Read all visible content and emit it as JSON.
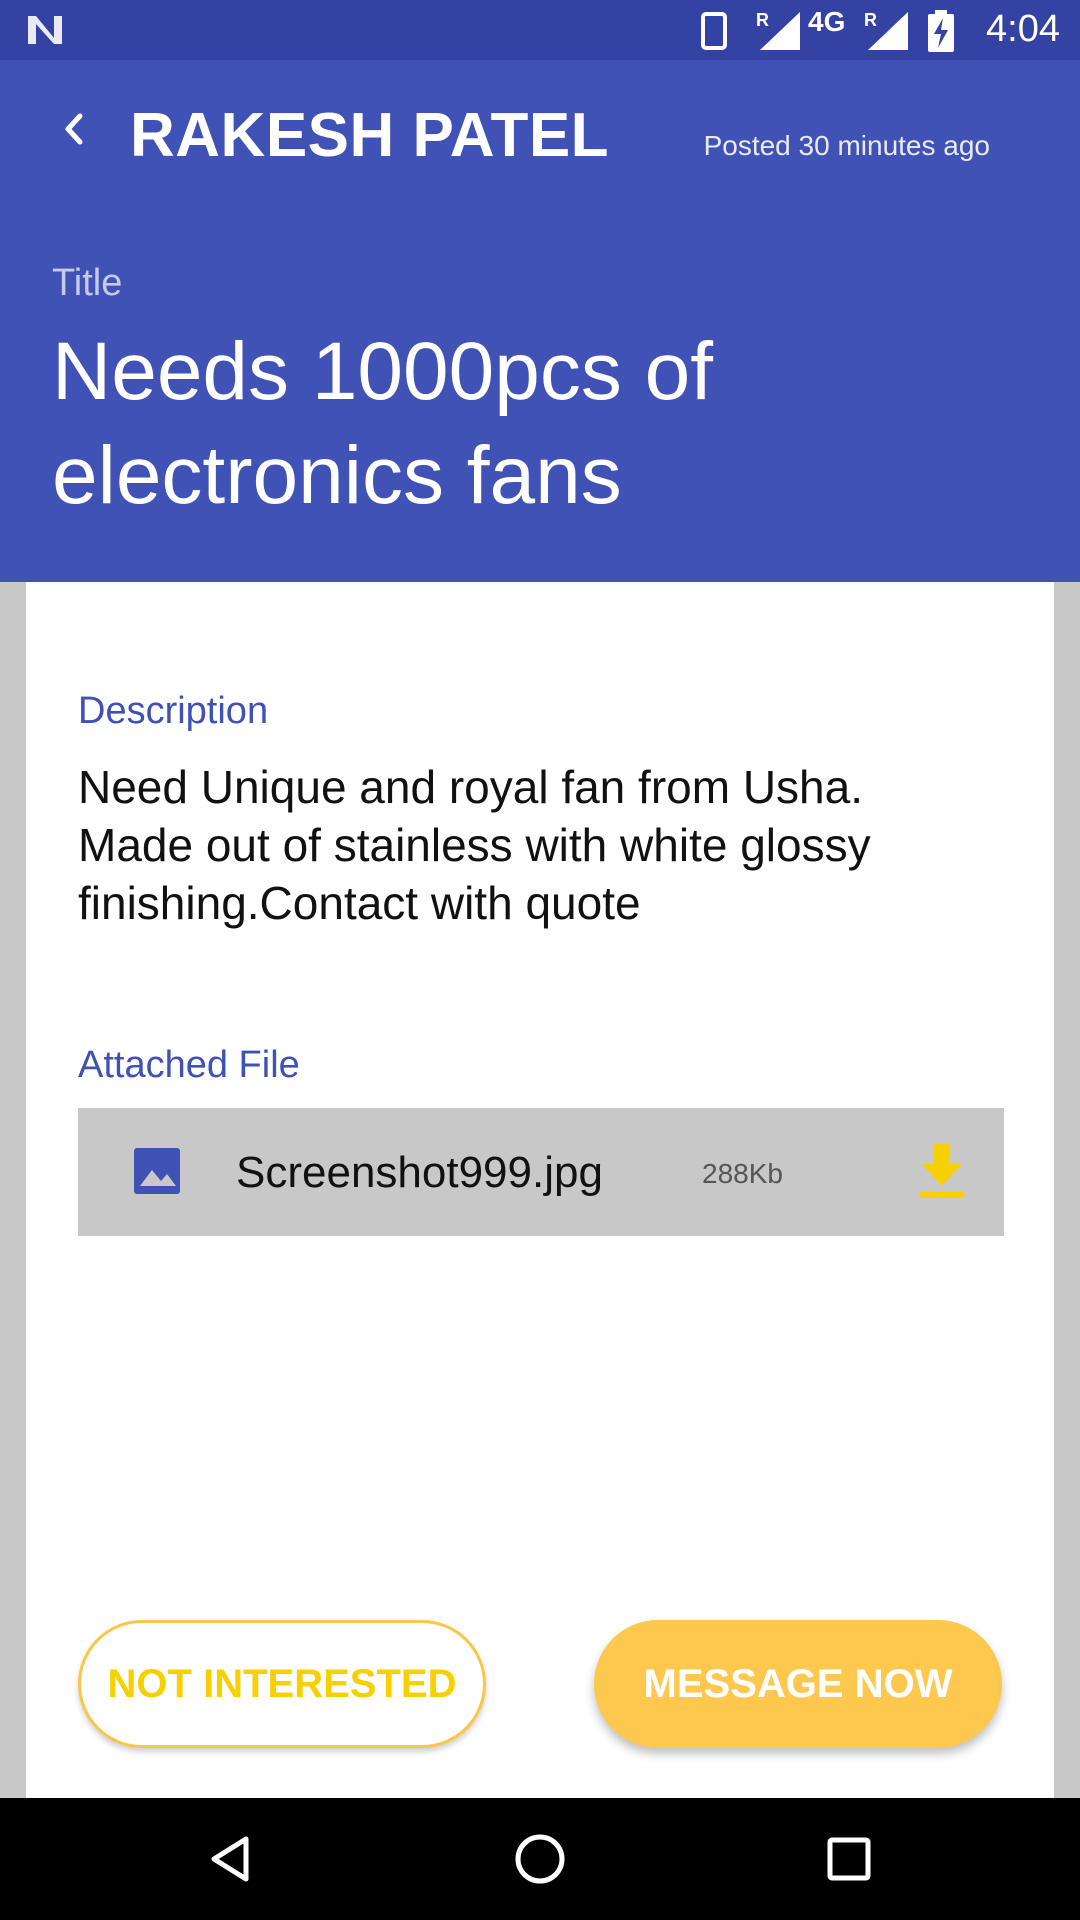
{
  "status_bar": {
    "network": "4G",
    "roaming_marker": "R",
    "time": "4:04",
    "icons": [
      "n-logo-icon",
      "phone-icon",
      "signal-icon",
      "battery-charging-icon"
    ]
  },
  "header": {
    "back_icon": "chevron-left-icon",
    "name": "RAKESH PATEL",
    "posted": "Posted 30 minutes ago",
    "title_label": "Title",
    "title": "Needs 1000pcs of electronics fans"
  },
  "content": {
    "description_label": "Description",
    "description": "Need Unique and royal fan from Usha. Made out of stainless with white glossy finishing.Contact with quote",
    "attached_label": "Attached File",
    "file": {
      "icon": "image-icon",
      "name": "Screenshot999.jpg",
      "size": "288Kb",
      "download_icon": "download-icon"
    }
  },
  "actions": {
    "not_interested": "NOT INTERESTED",
    "message_now": "MESSAGE NOW"
  },
  "colors": {
    "status_bar": "#3443a3",
    "header": "#4152b7",
    "accent_blue": "#3f51b5",
    "accent_yellow": "#fdc84d",
    "download_yellow": "#f7d000"
  },
  "nav_bar": {
    "icons": [
      "back-triangle-icon",
      "home-circle-icon",
      "recents-square-icon"
    ]
  }
}
